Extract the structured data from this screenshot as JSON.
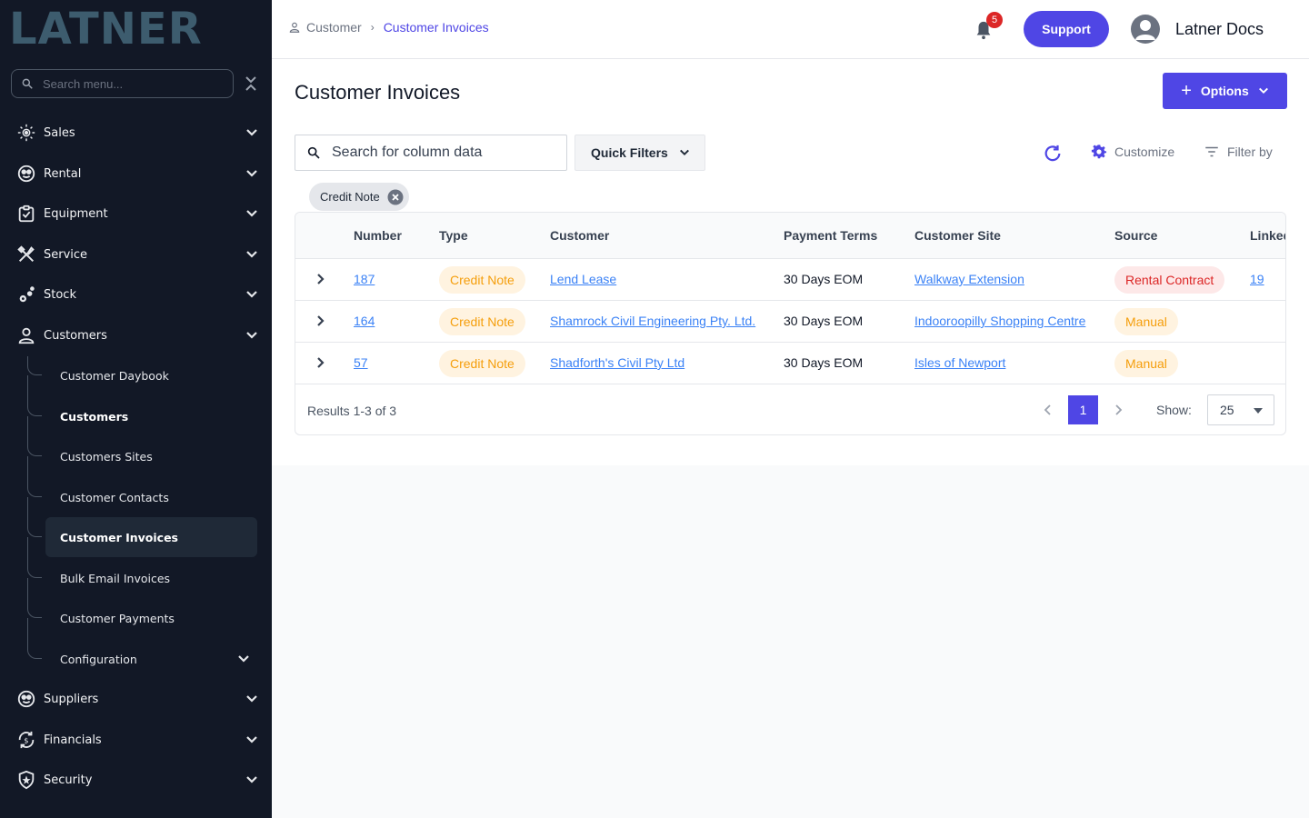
{
  "sidebar": {
    "logo": "LATNER",
    "search_placeholder": "Search menu...",
    "items": [
      {
        "label": "Sales",
        "icon": "sales-icon"
      },
      {
        "label": "Rental",
        "icon": "rental-icon"
      },
      {
        "label": "Equipment",
        "icon": "equipment-icon"
      },
      {
        "label": "Service",
        "icon": "service-icon"
      },
      {
        "label": "Stock",
        "icon": "stock-icon"
      },
      {
        "label": "Customers",
        "icon": "person-icon",
        "expanded": true
      },
      {
        "label": "Suppliers",
        "icon": "suppliers-icon"
      },
      {
        "label": "Financials",
        "icon": "financials-icon"
      },
      {
        "label": "Security",
        "icon": "shield-icon"
      }
    ],
    "customers_sub": [
      {
        "label": "Customer Daybook"
      },
      {
        "label": "Customers"
      },
      {
        "label": "Customers Sites"
      },
      {
        "label": "Customer Contacts"
      },
      {
        "label": "Customer Invoices"
      },
      {
        "label": "Bulk Email Invoices"
      },
      {
        "label": "Customer Payments"
      },
      {
        "label": "Configuration"
      }
    ]
  },
  "header": {
    "breadcrumb": [
      "Customer",
      "Customer Invoices"
    ],
    "notification_count": "5",
    "support_label": "Support",
    "user_name": "Latner Docs"
  },
  "main": {
    "title": "Customer Invoices",
    "options_label": "Options",
    "search_placeholder": "Search for column data",
    "quick_filters_label": "Quick Filters",
    "customize_label": "Customize",
    "filter_by_label": "Filter by",
    "active_filter_chip": "Credit Note"
  },
  "table": {
    "columns": [
      "Number",
      "Type",
      "Customer",
      "Payment Terms",
      "Customer Site",
      "Source",
      "Linked"
    ],
    "rows": [
      {
        "number": "187",
        "type": "Credit Note",
        "customer": "Lend Lease",
        "terms": "30 Days EOM",
        "site": "Walkway Extension",
        "source": "Rental Contract",
        "linked": "19"
      },
      {
        "number": "164",
        "type": "Credit Note",
        "customer": "Shamrock Civil Engineering Pty. Ltd.",
        "terms": "30 Days EOM",
        "site": "Indooroopilly Shopping Centre",
        "source": "Manual",
        "linked": ""
      },
      {
        "number": "57",
        "type": "Credit Note",
        "customer": "Shadforth's Civil Pty Ltd",
        "terms": "30 Days EOM",
        "site": "Isles of Newport",
        "source": "Manual",
        "linked": ""
      }
    ],
    "results_text": "Results 1-3 of 3",
    "current_page": "1",
    "show_label": "Show:",
    "page_size": "25"
  },
  "colors": {
    "accent": "#4f46e5",
    "sidebar_bg": "#121826",
    "link": "#3b82f6",
    "pill_orange_bg": "#fff3e0",
    "pill_orange_text": "#f59e0b",
    "pill_red_bg": "#fde8e8",
    "pill_red_text": "#dc2626"
  }
}
